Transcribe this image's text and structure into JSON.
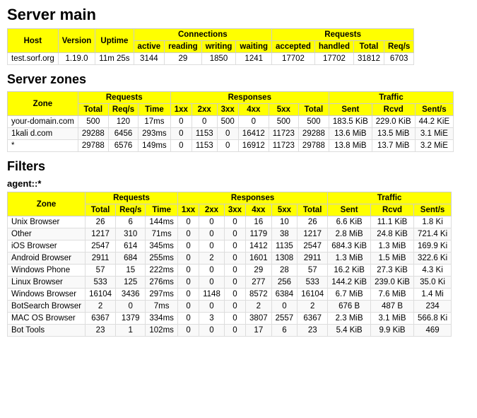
{
  "serverMain": {
    "title": "Server main",
    "tableHeaders": {
      "host": "Host",
      "version": "Version",
      "uptime": "Uptime",
      "connections": "Connections",
      "conn_active": "active",
      "conn_reading": "reading",
      "conn_writing": "writing",
      "conn_waiting": "waiting",
      "requests": "Requests",
      "req_accepted": "accepted",
      "req_handled": "handled",
      "req_total": "Total",
      "req_reqs": "Req/s"
    },
    "rows": [
      {
        "host": "test.sorf.org",
        "version": "1.19.0",
        "uptime": "11m 25s",
        "active": "3144",
        "reading": "29",
        "writing": "1850",
        "waiting": "1241",
        "accepted": "17702",
        "handled": "17702",
        "total": "31812",
        "reqs": "6703"
      }
    ]
  },
  "serverZones": {
    "title": "Server zones",
    "headers": {
      "zone": "Zone",
      "requests": "Requests",
      "req_total": "Total",
      "req_reqs": "Req/s",
      "req_time": "Time",
      "responses": "Responses",
      "res_1xx": "1xx",
      "res_2xx": "2xx",
      "res_3xx": "3xx",
      "res_4xx": "4xx",
      "res_5xx": "5xx",
      "res_total": "Total",
      "traffic": "Traffic",
      "traf_sent": "Sent",
      "traf_rcvd": "Rcvd",
      "traf_sents": "Sent/s"
    },
    "rows": [
      {
        "zone": "your-domain.com",
        "total": "500",
        "reqs": "120",
        "time": "17ms",
        "r1xx": "0",
        "r2xx": "0",
        "r3xx": "500",
        "r4xx": "0",
        "r5xx": "500",
        "rtotal": "500",
        "sent": "183.5 KiB",
        "rcvd": "229.0 KiB",
        "sents": "44.2 KiE"
      },
      {
        "zone": "1kali            d.com",
        "total": "29288",
        "reqs": "6456",
        "time": "293ms",
        "r1xx": "0",
        "r2xx": "1153",
        "r3xx": "0",
        "r4xx": "16412",
        "r5xx": "11723",
        "rtotal": "29288",
        "sent": "13.6 MiB",
        "rcvd": "13.5 MiB",
        "sents": "3.1 MiE"
      },
      {
        "zone": "*",
        "total": "29788",
        "reqs": "6576",
        "time": "149ms",
        "r1xx": "0",
        "r2xx": "1153",
        "r3xx": "0",
        "r4xx": "16912",
        "r5xx": "11723",
        "rtotal": "29788",
        "sent": "13.8 MiB",
        "rcvd": "13.7 MiB",
        "sents": "3.2 MiE"
      }
    ]
  },
  "filters": {
    "title": "Filters",
    "label": "agent::*",
    "headers": {
      "zone": "Zone",
      "requests": "Requests",
      "req_total": "Total",
      "req_reqs": "Req/s",
      "req_time": "Time",
      "responses": "Responses",
      "res_1xx": "1xx",
      "res_2xx": "2xx",
      "res_3xx": "3xx",
      "res_4xx": "4xx",
      "res_5xx": "5xx",
      "res_total": "Total",
      "traffic": "Traffic",
      "traf_sent": "Sent",
      "traf_rcvd": "Rcvd",
      "traf_sents": "Sent/s"
    },
    "rows": [
      {
        "zone": "Unix Browser",
        "total": "26",
        "reqs": "6",
        "time": "144ms",
        "r1xx": "0",
        "r2xx": "0",
        "r3xx": "0",
        "r4xx": "16",
        "r5xx": "10",
        "rtotal": "26",
        "sent": "6.6 KiB",
        "rcvd": "11.1 KiB",
        "sents": "1.8 Ki"
      },
      {
        "zone": "Other",
        "total": "1217",
        "reqs": "310",
        "time": "71ms",
        "r1xx": "0",
        "r2xx": "0",
        "r3xx": "0",
        "r4xx": "1179",
        "r5xx": "38",
        "rtotal": "1217",
        "sent": "2.8 MiB",
        "rcvd": "24.8 KiB",
        "sents": "721.4 Ki"
      },
      {
        "zone": "iOS Browser",
        "total": "2547",
        "reqs": "614",
        "time": "345ms",
        "r1xx": "0",
        "r2xx": "0",
        "r3xx": "0",
        "r4xx": "1412",
        "r5xx": "1135",
        "rtotal": "2547",
        "sent": "684.3 KiB",
        "rcvd": "1.3 MiB",
        "sents": "169.9 Ki"
      },
      {
        "zone": "Android Browser",
        "total": "2911",
        "reqs": "684",
        "time": "255ms",
        "r1xx": "0",
        "r2xx": "2",
        "r3xx": "0",
        "r4xx": "1601",
        "r5xx": "1308",
        "rtotal": "2911",
        "sent": "1.3 MiB",
        "rcvd": "1.5 MiB",
        "sents": "322.6 Ki"
      },
      {
        "zone": "Windows Phone",
        "total": "57",
        "reqs": "15",
        "time": "222ms",
        "r1xx": "0",
        "r2xx": "0",
        "r3xx": "0",
        "r4xx": "29",
        "r5xx": "28",
        "rtotal": "57",
        "sent": "16.2 KiB",
        "rcvd": "27.3 KiB",
        "sents": "4.3 Ki"
      },
      {
        "zone": "Linux Browser",
        "total": "533",
        "reqs": "125",
        "time": "276ms",
        "r1xx": "0",
        "r2xx": "0",
        "r3xx": "0",
        "r4xx": "277",
        "r5xx": "256",
        "rtotal": "533",
        "sent": "144.2 KiB",
        "rcvd": "239.0 KiB",
        "sents": "35.0 Ki"
      },
      {
        "zone": "Windows Browser",
        "total": "16104",
        "reqs": "3436",
        "time": "297ms",
        "r1xx": "0",
        "r2xx": "1148",
        "r3xx": "0",
        "r4xx": "8572",
        "r5xx": "6384",
        "rtotal": "16104",
        "sent": "6.7 MiB",
        "rcvd": "7.6 MiB",
        "sents": "1.4 Mi"
      },
      {
        "zone": "BotSearch Browser",
        "total": "2",
        "reqs": "0",
        "time": "7ms",
        "r1xx": "0",
        "r2xx": "0",
        "r3xx": "0",
        "r4xx": "2",
        "r5xx": "0",
        "rtotal": "2",
        "sent": "676 B",
        "rcvd": "487 B",
        "sents": "234"
      },
      {
        "zone": "MAC OS Browser",
        "total": "6367",
        "reqs": "1379",
        "time": "334ms",
        "r1xx": "0",
        "r2xx": "3",
        "r3xx": "0",
        "r4xx": "3807",
        "r5xx": "2557",
        "rtotal": "6367",
        "sent": "2.3 MiB",
        "rcvd": "3.1 MiB",
        "sents": "566.8 Ki"
      },
      {
        "zone": "Bot Tools",
        "total": "23",
        "reqs": "1",
        "time": "102ms",
        "r1xx": "0",
        "r2xx": "0",
        "r3xx": "0",
        "r4xx": "17",
        "r5xx": "6",
        "rtotal": "23",
        "sent": "5.4 KiB",
        "rcvd": "9.9 KiB",
        "sents": "469"
      }
    ]
  }
}
